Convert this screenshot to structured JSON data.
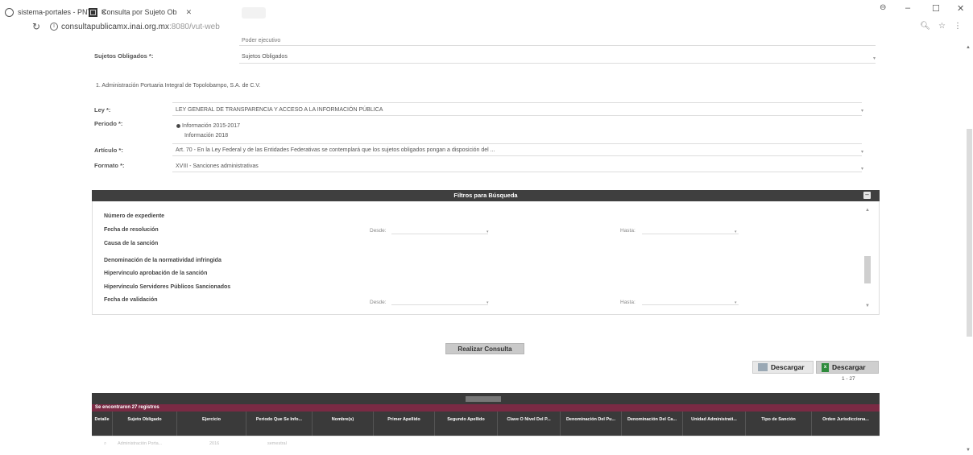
{
  "browser": {
    "tabs": [
      {
        "label": "sistema-portales - PNT"
      },
      {
        "label": "Consulta por Sujeto Ob"
      }
    ],
    "url_main": "consultapublicamx.inai.org.mx",
    "url_rest": ":8080/vut-web",
    "window_controls": {
      "minimize": "–",
      "maximize": "☐",
      "close": "✕"
    }
  },
  "form": {
    "tipo_value": "Poder ejecutivo",
    "sujetos_label": "Sujetos Obligados *:",
    "sujetos_value": "Sujetos Obligados",
    "sujeto_selected": "1. Administración Portuaria Integral de Topolobampo, S.A. de C.V.",
    "ley_label": "Ley *:",
    "ley_value": "LEY GENERAL DE TRANSPARENCIA Y ACCESO A LA INFORMACIÓN PÚBLICA",
    "periodo_label": "Periodo *:",
    "periodo_opt1": "Información 2015-2017",
    "periodo_opt2": "Información 2018",
    "articulo_label": "Artículo *:",
    "articulo_value": "Art. 70 - En la Ley Federal y de las Entidades Federativas se contemplará que los sujetos obligados pongan a disposición del ...",
    "formato_label": "Formato *:",
    "formato_value": "XVIII - Sanciones administrativas"
  },
  "filters": {
    "title": "Filtros para Búsqueda",
    "fields": [
      "Número de expediente",
      "Fecha de resolución",
      "Causa de la sanción",
      "Denominación de la normatividad infringida",
      "Hipervínculo aprobación de la sanción",
      "Hipervínculo Servidores Públicos Sancionados",
      "Fecha de validación"
    ],
    "desde": "Desde:",
    "hasta": "Hasta:"
  },
  "actions": {
    "consulta": "Realizar Consulta",
    "descargar1": "Descargar",
    "descargar2": "Descargar",
    "pager": "1 - 27"
  },
  "grid": {
    "records": "Se encontraron 27 registros",
    "columns": [
      "Detalle",
      "Sujeto Obligado",
      "Ejercicio",
      "Periodo Que Se Info...",
      "Nombre(s)",
      "Primer Apellido",
      "Segundo Apellido",
      "Clave O Nivel Del P...",
      "Denominación Del Pu...",
      "Denominación Del Ca...",
      "Unidad Administrati...",
      "Tipo de Sanción",
      "Orden Jurisdicciona..."
    ],
    "first_row": [
      "Administración Porta...",
      "2016",
      "semestral"
    ]
  }
}
